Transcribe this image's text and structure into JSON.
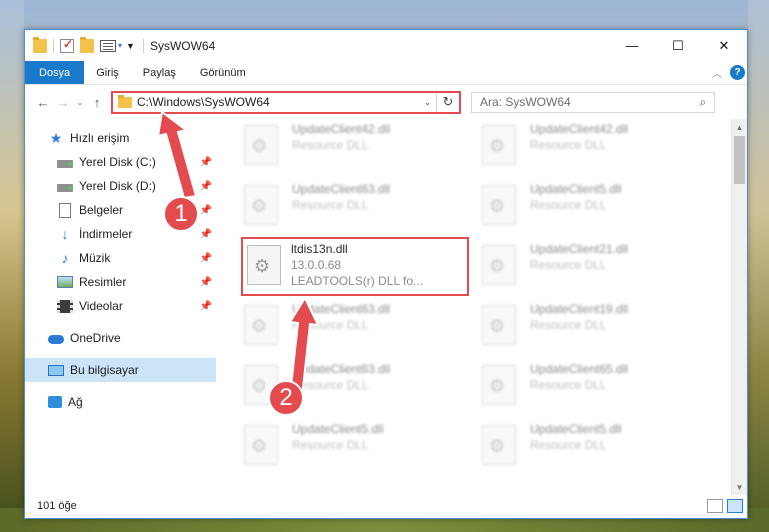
{
  "window": {
    "title": "SysWOW64",
    "controls": {
      "minimize": "—",
      "maximize": "☐",
      "close": "✕"
    }
  },
  "ribbon": {
    "tabs": [
      "Dosya",
      "Giriş",
      "Paylaş",
      "Görünüm"
    ],
    "help": "?"
  },
  "address": {
    "path": "C:\\Windows\\SysWOW64",
    "search_placeholder": "Ara: SysWOW64"
  },
  "nav": {
    "quick_access": "Hızlı erişim",
    "items": [
      {
        "label": "Yerel Disk (C:)",
        "icon": "disk-icon"
      },
      {
        "label": "Yerel Disk (D:)",
        "icon": "disk-icon"
      },
      {
        "label": "Belgeler",
        "icon": "documents-icon"
      },
      {
        "label": "İndirmeler",
        "icon": "download-icon"
      },
      {
        "label": "Müzik",
        "icon": "music-icon"
      },
      {
        "label": "Resimler",
        "icon": "pictures-icon"
      },
      {
        "label": "Videolar",
        "icon": "videos-icon"
      }
    ],
    "onedrive": "OneDrive",
    "this_pc": "Bu bilgisayar",
    "network": "Ağ"
  },
  "files": {
    "col1": [
      {
        "name": "UpdateClient42.dll",
        "desc": "Resource DLL"
      },
      {
        "name": "UpdateClient63.dll",
        "desc": "Resource DLL"
      },
      {
        "name": "ltdis13n.dll",
        "version": "13.0.0.68",
        "desc": "LEADTOOLS(r) DLL fo..."
      },
      {
        "name": "UpdateClient63.dll",
        "desc": "Resource DLL"
      },
      {
        "name": "UpdateClient63.dll",
        "desc": "Resource DLL"
      },
      {
        "name": "UpdateClient5.dll",
        "desc": "Resource DLL"
      }
    ],
    "col2": [
      {
        "name": "UpdateClient42.dll",
        "desc": "Resource DLL"
      },
      {
        "name": "UpdateClient5.dll",
        "desc": "Resource DLL"
      },
      {
        "name": "UpdateClient21.dll",
        "desc": "Resource DLL"
      },
      {
        "name": "UpdateClient19.dll",
        "desc": "Resource DLL"
      },
      {
        "name": "UpdateClient65.dll",
        "desc": "Resource DLL"
      },
      {
        "name": "UpdateClient5.dll",
        "desc": "Resource DLL"
      }
    ]
  },
  "status": {
    "count": "101 öğe"
  },
  "annotations": {
    "badge1": "1",
    "badge2": "2",
    "color": "#e34b4f"
  }
}
